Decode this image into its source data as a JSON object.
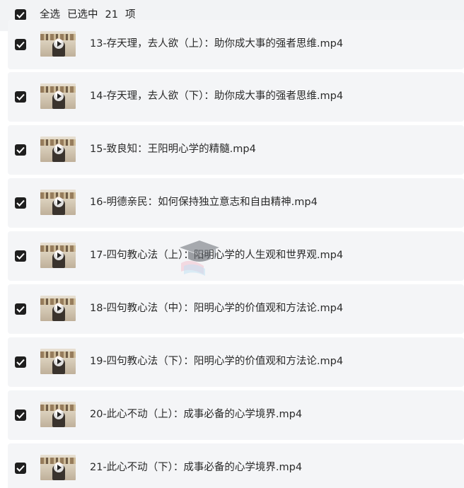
{
  "header": {
    "select_all_label": "全选",
    "selected_prefix": "已选中",
    "selected_count": "21",
    "selected_suffix": "项"
  },
  "files": [
    {
      "name": "13-存天理，去人欲（上）：助你成大事的强者思维.mp4",
      "checked": true
    },
    {
      "name": "14-存天理，去人欲（下）：助你成大事的强者思维.mp4",
      "checked": true
    },
    {
      "name": "15-致良知：王阳明心学的精髓.mp4",
      "checked": true
    },
    {
      "name": "16-明德亲民：如何保持独立意志和自由精神.mp4",
      "checked": true
    },
    {
      "name": "17-四句教心法（上）：阳明心学的人生观和世界观.mp4",
      "checked": true
    },
    {
      "name": "18-四句教心法（中）：阳明心学的价值观和方法论.mp4",
      "checked": true
    },
    {
      "name": "19-四句教心法（下）：阳明心学的价值观和方法论.mp4",
      "checked": true
    },
    {
      "name": "20-此心不动（上）：成事必备的心学境界.mp4",
      "checked": true
    },
    {
      "name": "21-此心不动（下）：成事必备的心学境界.mp4",
      "checked": true
    }
  ],
  "icons": {
    "checkbox": "checkbox-checked-icon",
    "play": "play-icon",
    "watermark": "graduation-cap-icon"
  },
  "colors": {
    "checkbox_fill": "#1f1f1f",
    "row_background": "#f4f5f7",
    "text": "#2a2a2a"
  }
}
